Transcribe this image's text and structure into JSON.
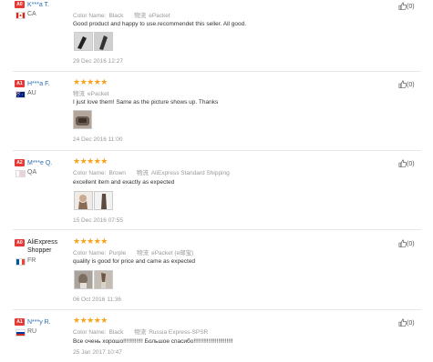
{
  "reviews": [
    {
      "level": "A0",
      "name": "K***a T.",
      "country": "CA",
      "color_key": "Color Name:",
      "color_value": "Black",
      "ship_icon": "物流",
      "shipping": "ePacket",
      "text": "Good product and happy to use.recommendet this seller. All good.",
      "date": "29 Dec 2016 12:27",
      "likes": "(0)"
    },
    {
      "level": "A1",
      "name": "H***a F.",
      "country": "AU",
      "color_key": "",
      "color_value": "",
      "ship_icon": "物流",
      "shipping": "ePacket",
      "text": "I just love them! Same as the picture shows up. Thanks",
      "date": "24 Dec 2016 11:00",
      "likes": "(0)"
    },
    {
      "level": "A2",
      "name": "M***e Q.",
      "country": "QA",
      "color_key": "Color Name:",
      "color_value": "Brown",
      "ship_icon": "物流",
      "shipping": "AliExpress Standard Shipping",
      "text": "excellent item and exactly as expected",
      "date": "15 Dec 2016 07:55",
      "likes": "(0)"
    },
    {
      "level": "A0",
      "name": "AliExpress Shopper",
      "country": "FR",
      "color_key": "Color Name:",
      "color_value": "Purple",
      "ship_icon": "物流",
      "shipping": "ePacket (e邮宝)",
      "text": "quality is good for price and came as expected",
      "date": "06 Oct 2016 11:36",
      "likes": "(0)"
    },
    {
      "level": "A1",
      "name": "N***y R.",
      "country": "RU",
      "color_key": "Color Name:",
      "color_value": "Black",
      "ship_icon": "物流",
      "shipping": "Russia Express-SPSR",
      "text": "Все очень хорошо!!!!!!!!!!!! Большое спасибо!!!!!!!!!!!!!!!!!!!!!!!!",
      "date": "25 Jan 2017 10:47",
      "likes": "(0)"
    }
  ],
  "colors": {
    "accent": "#2b6cb0",
    "stars": "#f7a21c",
    "level_badge": "#e53935",
    "meta": "#999999"
  },
  "icons": {
    "rating": "star-icon",
    "like": "thumbs-up-icon"
  },
  "rating_stars": 5
}
